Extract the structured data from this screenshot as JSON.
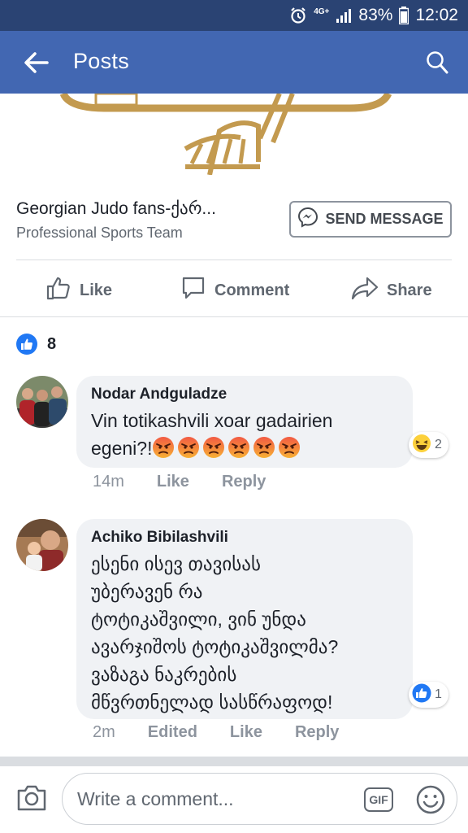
{
  "status_bar": {
    "network": "4G+",
    "battery": "83%",
    "time": "12:02"
  },
  "app_bar": {
    "title": "Posts"
  },
  "page": {
    "name": "Georgian Judo fans-ქარ...",
    "category": "Professional Sports Team",
    "send_message_label": "SEND MESSAGE"
  },
  "actions": {
    "like": "Like",
    "comment": "Comment",
    "share": "Share"
  },
  "likes_count": "8",
  "comments": [
    {
      "author": "Nodar Andguladze",
      "text_line1": "Vin totikashvili xoar gadairien",
      "text_line2": "egeni?!",
      "emoji_count": 6,
      "reaction_count": "2",
      "time": "14m",
      "like": "Like",
      "reply": "Reply"
    },
    {
      "author": "Achiko Bibilashvili",
      "lines": [
        "ესენი ისევ თავისას",
        "უბერავენ რა",
        "ტოტიკაშვილი, ვინ უნდა",
        "ავარჯიშოს ტოტიკაშვილმა?",
        "ვაზაგა ნაკრების",
        "მწვრთნელად სასწრაფოდ!"
      ],
      "reaction_count": "1",
      "time": "2m",
      "edited": "Edited",
      "like": "Like",
      "reply": "Reply"
    }
  ],
  "composer": {
    "placeholder": "Write a comment...",
    "gif": "GIF"
  },
  "colors": {
    "brand": "#4267b2",
    "status_bar": "#2a4373",
    "like_blue": "#2078f4",
    "bubble": "#f0f2f5"
  }
}
